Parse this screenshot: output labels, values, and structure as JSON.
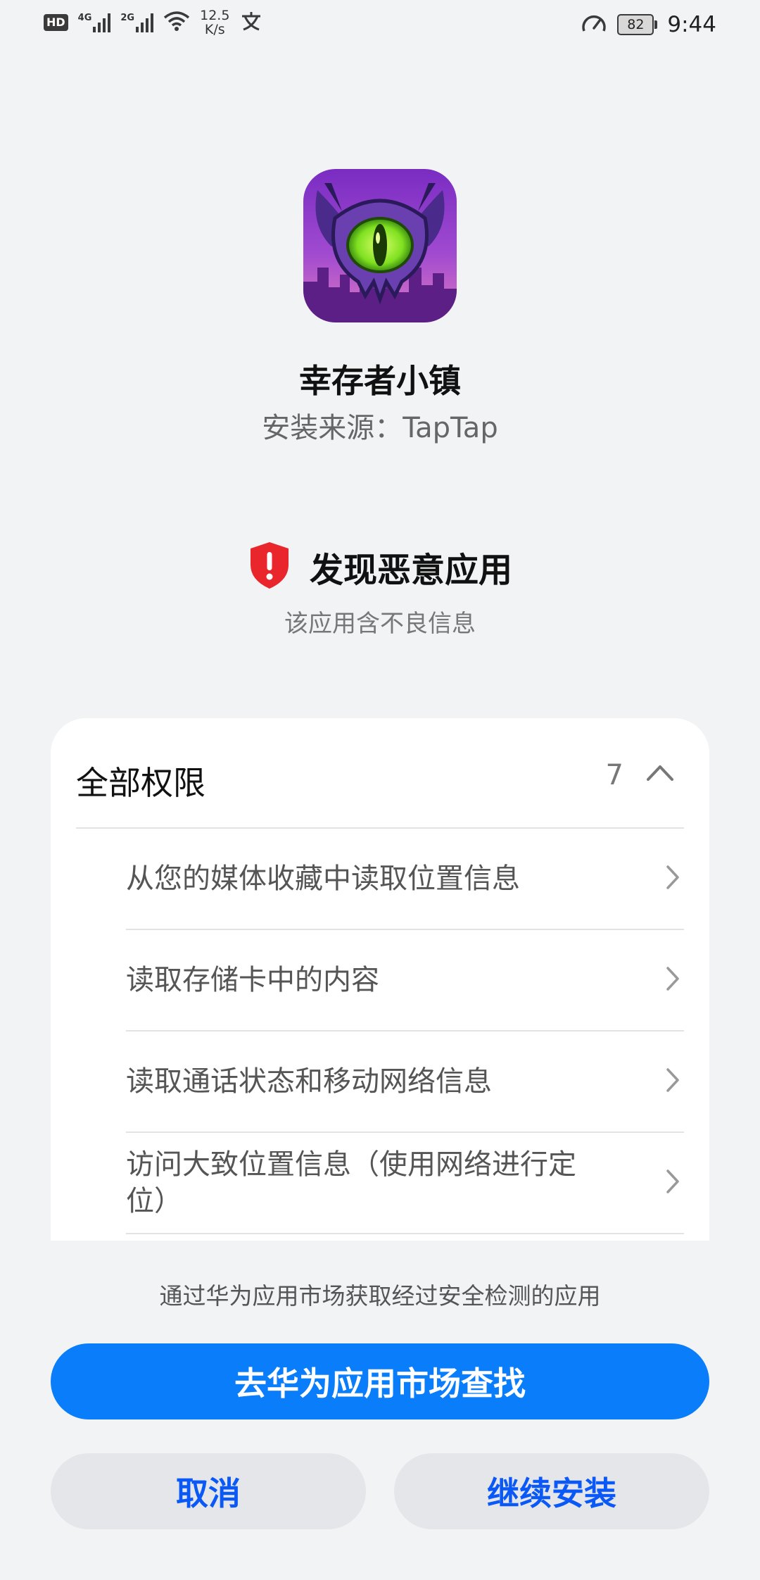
{
  "status_bar": {
    "hd_label": "HD",
    "network_1": "4G",
    "network_2": "2G",
    "speed_value": "12.5",
    "speed_unit": "K/s",
    "battery_level": "82",
    "time": "9:44"
  },
  "app": {
    "name": "幸存者小镇",
    "install_source": "安装来源：TapTap",
    "icon": "game-app-icon"
  },
  "warning": {
    "title": "发现恶意应用",
    "subtitle": "该应用含不良信息",
    "icon": "shield-alert-icon",
    "color": "#e8262c"
  },
  "permissions": {
    "title": "全部权限",
    "count": "7",
    "items": [
      {
        "label": "从您的媒体收藏中读取位置信息"
      },
      {
        "label": "读取存储卡中的内容"
      },
      {
        "label": "读取通话状态和移动网络信息"
      },
      {
        "label": "访问大致位置信息（使用网络进行定位）"
      }
    ]
  },
  "footer": {
    "note": "通过华为应用市场获取经过安全检测的应用",
    "primary_button": "去华为应用市场查找",
    "cancel_button": "取消",
    "continue_button": "继续安装",
    "primary_color": "#0a7dfb",
    "secondary_text_color": "#0a59f7"
  }
}
